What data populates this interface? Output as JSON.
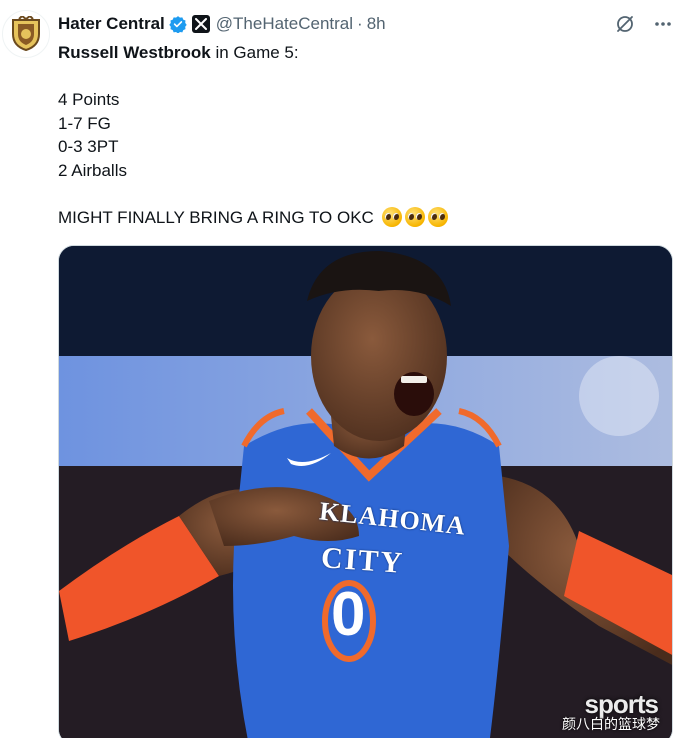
{
  "author": {
    "display_name": "Hater Central",
    "handle": "@TheHateCentral",
    "separator": "·",
    "timestamp": "8h",
    "verified_color": "#1d9bf0"
  },
  "tweet": {
    "subject": "Russell Westbrook",
    "intro_rest": " in Game 5:",
    "stats": [
      "4 Points",
      "1-7 FG",
      "0-3 3PT",
      "2 Airballs"
    ],
    "closing": "MIGHT FINALLY BRING A RING TO OKC",
    "emoji_count": 3,
    "emoji_name": "pleading-face-emoji"
  },
  "media": {
    "jersey_team": "OKLAHOMA CITY",
    "jersey_line1": "KLAHOMA",
    "jersey_line2": "CITY",
    "jersey_number": "0",
    "watermark_logo": "sports",
    "watermark_text": "颜八白的篮球梦"
  },
  "colors": {
    "jersey_blue": "#2f67d4",
    "jersey_orange": "#f06a2c",
    "text_secondary": "#536471"
  }
}
